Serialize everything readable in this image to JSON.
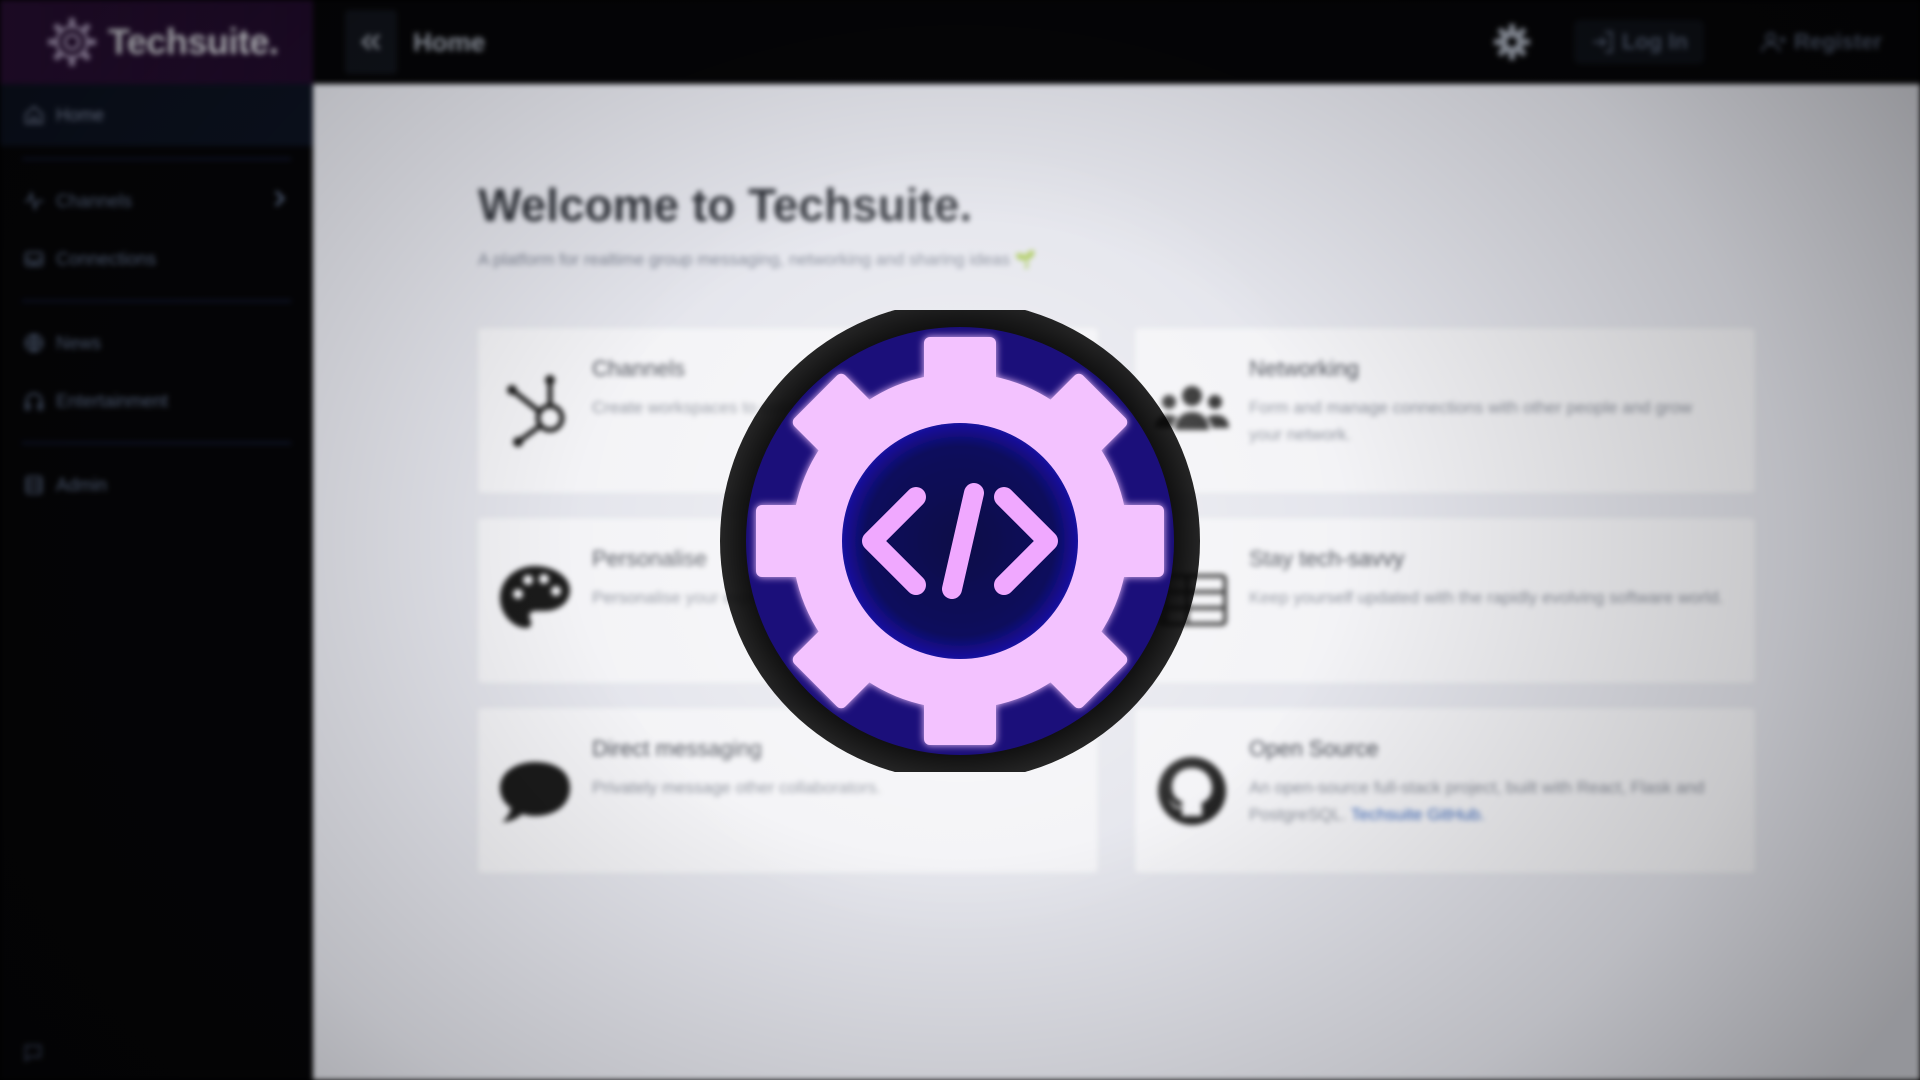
{
  "brand": {
    "name": "Techsuite."
  },
  "sidebar": {
    "items": [
      {
        "label": "Home",
        "icon": "home-icon",
        "active": true
      },
      {
        "label": "Channels",
        "icon": "activity-icon",
        "has_submenu": true
      },
      {
        "label": "Connections",
        "icon": "inbox-icon"
      },
      {
        "label": "News",
        "icon": "globe-icon"
      },
      {
        "label": "Entertainment",
        "icon": "headphones-icon"
      },
      {
        "label": "Admin",
        "icon": "database-icon"
      }
    ],
    "footer_icon": "chat-icon"
  },
  "topbar": {
    "title": "Home",
    "login_label": "Log In",
    "register_label": "Register"
  },
  "main": {
    "welcome": "Welcome to Techsuite.",
    "tagline": "A platform for realtime group messaging, networking and sharing ideas",
    "tagline_emoji": "🌱",
    "cards": [
      {
        "title": "Channels",
        "desc": "Create workspaces to collaborate on group projects.",
        "icon": "hub-icon"
      },
      {
        "title": "Networking",
        "desc": "Form and manage connections with other people and grow your network.",
        "icon": "users-icon"
      },
      {
        "title": "Personalise",
        "desc": "Personalise your experience.",
        "icon": "palette-icon"
      },
      {
        "title": "Stay tech-savvy",
        "desc": "Keep yourself updated with the rapidly evolving software world.",
        "icon": "newspaper-icon"
      },
      {
        "title": "Direct messaging",
        "desc": "Privately message other collaborators.",
        "icon": "speech-bubble-icon"
      },
      {
        "title": "Open Source",
        "desc": "An open-source full-stack project, built with React, Flask and PostgreSQL.",
        "link": "Techsuite GitHub.",
        "icon": "github-icon"
      }
    ]
  },
  "overlay": {
    "icon": "code-gear-logo-icon"
  },
  "colors": {
    "sidebar_bg": "#050507",
    "brand_bg": "#2a0f36",
    "main_bg": "#e4e5ec",
    "card_bg": "#f3f3f6",
    "logo_accent": "#e8a6ff",
    "logo_core": "#0b0a5c",
    "link": "#3a66b8"
  }
}
